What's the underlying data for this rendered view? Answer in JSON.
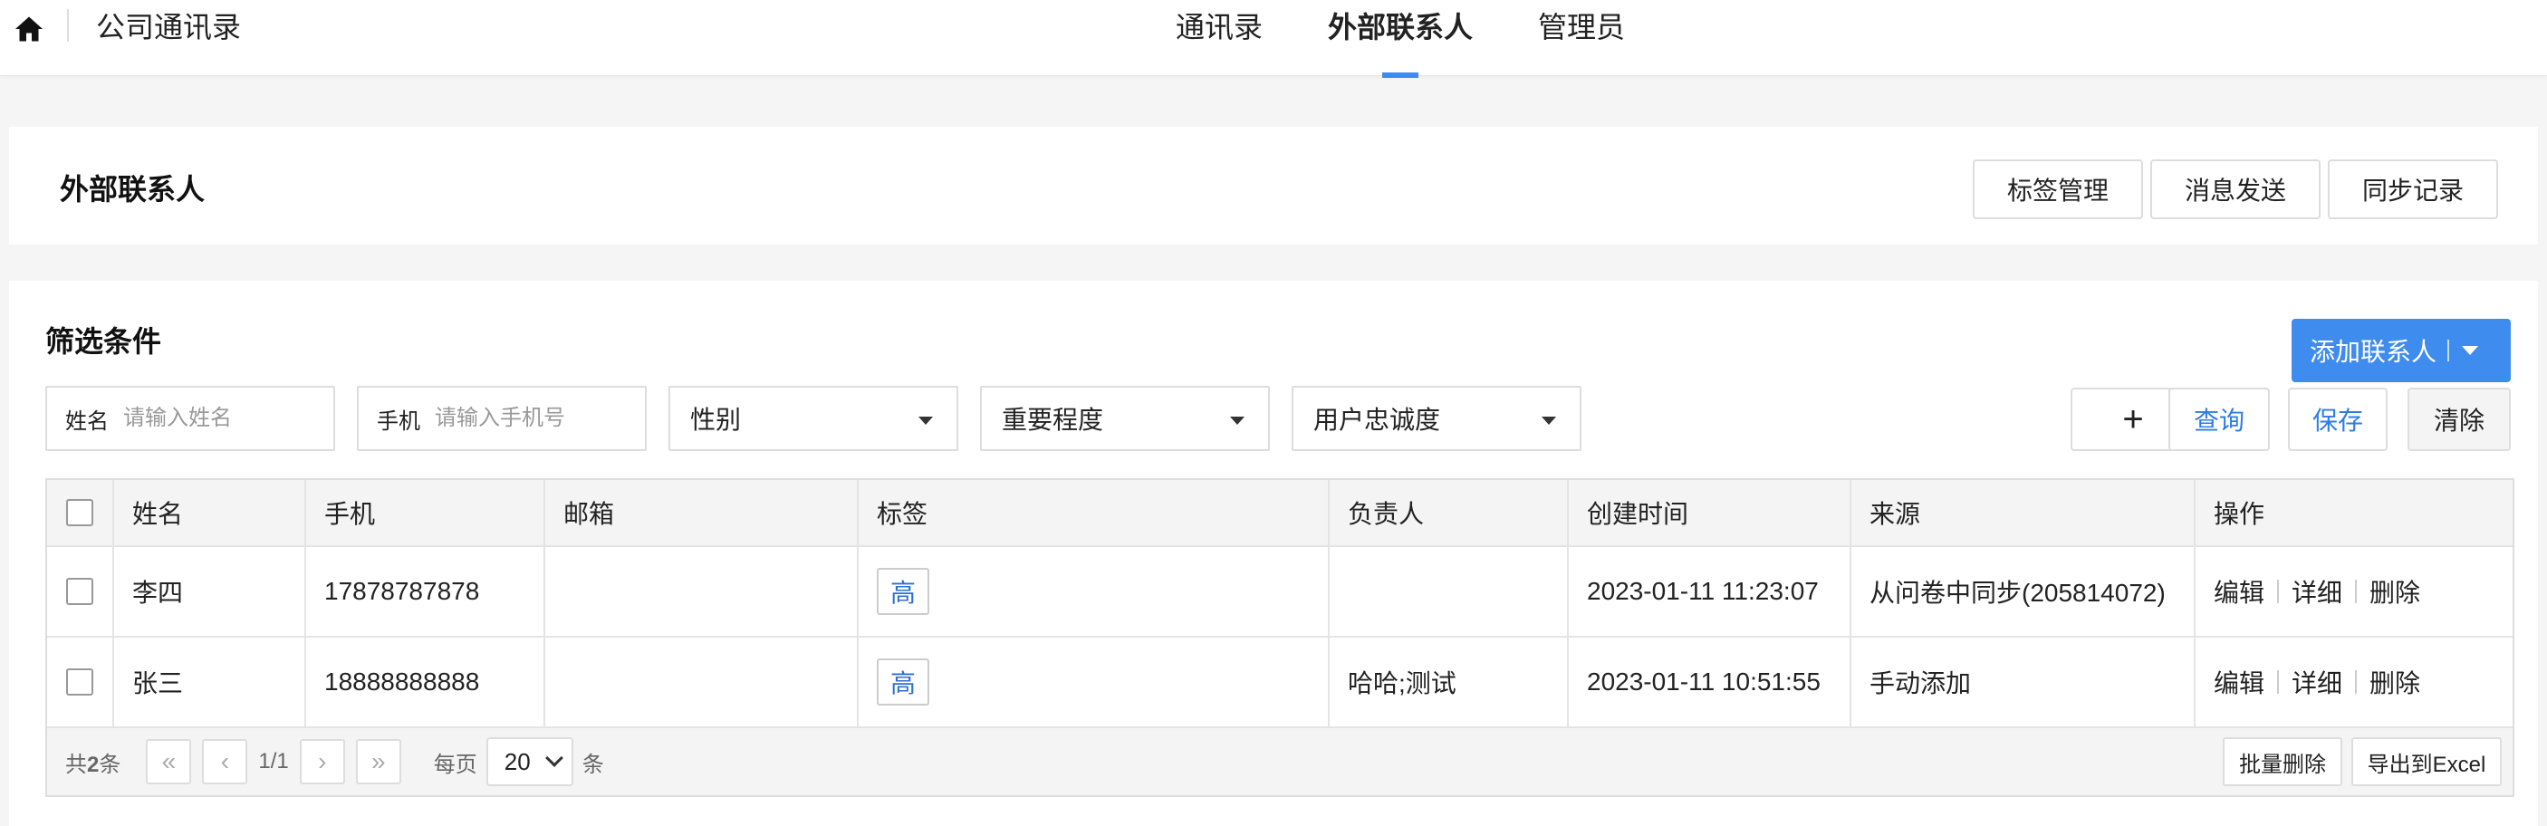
{
  "topbar": {
    "app_title": "公司通讯录",
    "home_icon": "home-icon",
    "nav": [
      {
        "label": "通讯录",
        "active": false
      },
      {
        "label": "外部联系人",
        "active": true
      },
      {
        "label": "管理员",
        "active": false
      }
    ],
    "accent_color": "#3a8cf0"
  },
  "header": {
    "title": "外部联系人",
    "buttons": [
      "标签管理",
      "消息发送",
      "同步记录"
    ]
  },
  "filters": {
    "section_title": "筛选条件",
    "add_contact_label": "添加联系人",
    "name": {
      "label": "姓名",
      "placeholder": "请输入姓名"
    },
    "phone": {
      "label": "手机",
      "placeholder": "请输入手机号"
    },
    "gender": "性别",
    "importance": "重要程度",
    "loyalty": "用户忠诚度",
    "plus_label": "+",
    "query_label": "查询",
    "save_label": "保存",
    "clear_label": "清除"
  },
  "table": {
    "headers": [
      "姓名",
      "手机",
      "邮箱",
      "标签",
      "负责人",
      "创建时间",
      "来源",
      "操作"
    ],
    "rows": [
      {
        "name": "李四",
        "phone": "17878787878",
        "email": "",
        "tag": "高",
        "owner": "",
        "created": "2023-01-11 11:23:07",
        "source": "从问卷中同步(205814072)"
      },
      {
        "name": "张三",
        "phone": "18888888888",
        "email": "",
        "tag": "高",
        "owner": "哈哈;测试",
        "created": "2023-01-11 10:51:55",
        "source": "手动添加"
      }
    ],
    "actions": {
      "edit": "编辑",
      "detail": "详细",
      "delete": "删除"
    }
  },
  "pagination": {
    "total_prefix": "共",
    "total_count": "2",
    "total_suffix": "条",
    "first": "«",
    "prev": "‹",
    "page_info": "1/1",
    "next": "›",
    "last": "»",
    "per_page_label": "每页",
    "per_page_value": "20",
    "per_page_unit": "条",
    "batch_delete": "批量删除",
    "export": "导出到Excel"
  }
}
